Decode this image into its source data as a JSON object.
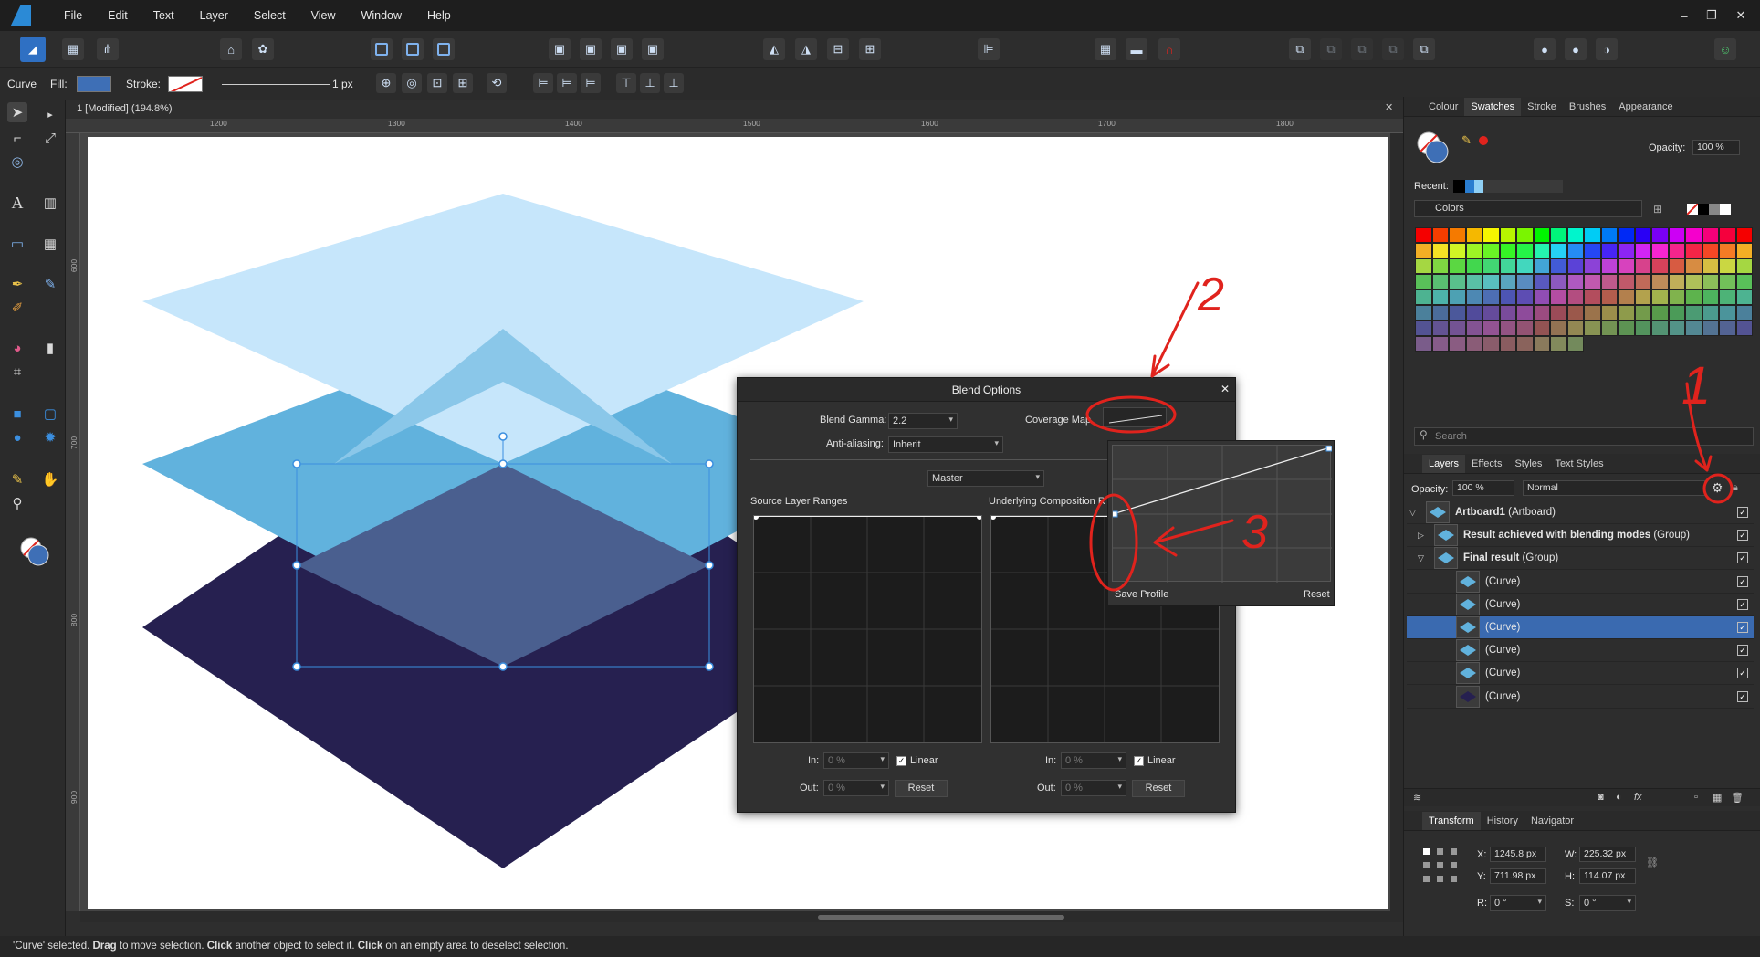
{
  "menu": [
    "File",
    "Edit",
    "Text",
    "Layer",
    "Select",
    "View",
    "Window",
    "Help"
  ],
  "window_controls": {
    "minimize": "–",
    "restore": "❐",
    "close": "✕"
  },
  "context_bar": {
    "tool": "Curve",
    "fill_label": "Fill:",
    "stroke_label": "Stroke:",
    "stroke_width": "1 px"
  },
  "document": {
    "tab_title": "1 [Modified] (194.8%)",
    "close": "✕"
  },
  "rulers": {
    "h": [
      "1200",
      "1300",
      "1400",
      "1500",
      "1600",
      "1700",
      "1800"
    ],
    "v": [
      "600",
      "700",
      "800",
      "900"
    ]
  },
  "dialog": {
    "title": "Blend Options",
    "blend_gamma_label": "Blend Gamma:",
    "blend_gamma_value": "2.2",
    "coverage_map_label": "Coverage Map",
    "anti_aliasing_label": "Anti-aliasing:",
    "anti_aliasing_value": "Inherit",
    "channel": "Master",
    "source_label": "Source Layer Ranges",
    "underlying_label": "Underlying Composition R",
    "in_label": "In:",
    "out_label": "Out:",
    "in_value": "0 %",
    "out_value": "0 %",
    "linear_label": "Linear",
    "reset_label": "Reset"
  },
  "popup": {
    "save_profile": "Save Profile",
    "reset": "Reset"
  },
  "annotations": {
    "a1": "1",
    "a2": "2",
    "a3": "3"
  },
  "right_panel": {
    "top_tabs": [
      "Colour",
      "Swatches",
      "Stroke",
      "Brushes",
      "Appearance"
    ],
    "opacity_label": "Opacity:",
    "opacity_value": "100 %",
    "recent_label": "Recent:",
    "palette": "Colors",
    "search_placeholder": "Search",
    "layer_tabs": [
      "Layers",
      "Effects",
      "Styles",
      "Text Styles"
    ],
    "layer_opacity_value": "100 %",
    "blend_mode": "Normal",
    "layers": [
      {
        "name": "Artboard1",
        "suffix": " (Artboard)",
        "bold": true,
        "sel": false
      },
      {
        "name": "Result achieved with blending modes",
        "suffix": " (Group)",
        "bold": true,
        "sel": false
      },
      {
        "name": "Final result",
        "suffix": " (Group)",
        "bold": true,
        "sel": false
      },
      {
        "name": "(Curve)",
        "suffix": "",
        "bold": false,
        "sel": false
      },
      {
        "name": "(Curve)",
        "suffix": "",
        "bold": false,
        "sel": false
      },
      {
        "name": "(Curve)",
        "suffix": "",
        "bold": false,
        "sel": true
      },
      {
        "name": "(Curve)",
        "suffix": "",
        "bold": false,
        "sel": false
      },
      {
        "name": "(Curve)",
        "suffix": "",
        "bold": false,
        "sel": false
      },
      {
        "name": "(Curve)",
        "suffix": "",
        "bold": false,
        "sel": false
      }
    ],
    "bottom_tabs": [
      "Transform",
      "History",
      "Navigator"
    ],
    "transform": {
      "x_label": "X:",
      "x": "1245.8 px",
      "y_label": "Y:",
      "y": "711.98 px",
      "w_label": "W:",
      "w": "225.32 px",
      "h_label": "H:",
      "h": "114.07 px",
      "r_label": "R:",
      "r": "0 °",
      "s_label": "S:",
      "s": "0 °"
    }
  },
  "colors": {
    "accent": "#2f70c3",
    "selection": "#3a6ab0",
    "annotation": "#e0231d",
    "shape_top": "#c6e6fb",
    "shape_mid": "#61b2dd",
    "shape_dark": "#262050",
    "shape_overlap": "#4a5f8f"
  },
  "status": {
    "pre": "'Curve' selected. ",
    "drag": "Drag",
    "t1": " to move selection. ",
    "click": "Click",
    "t2": " another object to select it. ",
    "click2": "Click",
    "t3": " on an empty area to deselect selection."
  }
}
